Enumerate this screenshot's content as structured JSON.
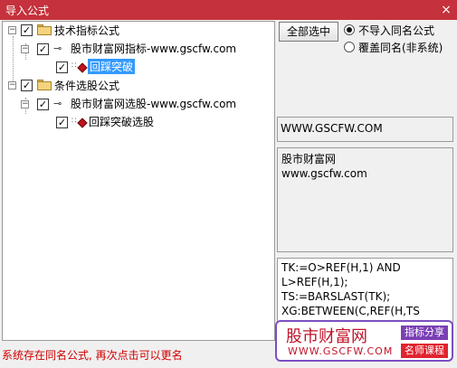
{
  "window": {
    "title": "导入公式",
    "close": "×"
  },
  "tree": {
    "n1": {
      "label": "技术指标公式"
    },
    "n1_1": {
      "label": "股市财富网指标-www.gscfw.com"
    },
    "n1_1_1": {
      "label": "回踩突破"
    },
    "n2": {
      "label": "条件选股公式"
    },
    "n2_1": {
      "label": "股市财富网选股-www.gscfw.com"
    },
    "n2_1_1": {
      "label": "回踩突破选股"
    }
  },
  "controls": {
    "select_all": "全部选中",
    "radio_skip": "不导入同名公式",
    "radio_overwrite": "覆盖同名(非系统)"
  },
  "url": "WWW.GSCFW.COM",
  "description": [
    "股市财富网",
    "www.gscfw.com"
  ],
  "code": [
    "TK:=O>REF(H,1) AND",
    "L>REF(H,1);",
    "TS:=BARSLAST(TK);",
    "XG:BETWEEN(C,REF(H,TS"
  ],
  "status": "系统存在同名公式, 再次点击可以更名",
  "watermark": {
    "name": "股市财富网",
    "url": "WWW.GSCFW.COM",
    "badge1": "指标分享",
    "badge2": "名师课程"
  },
  "icons": {
    "close": "close-icon",
    "folder": "folder-icon",
    "key": "key-icon",
    "formula": "formula-icon"
  }
}
